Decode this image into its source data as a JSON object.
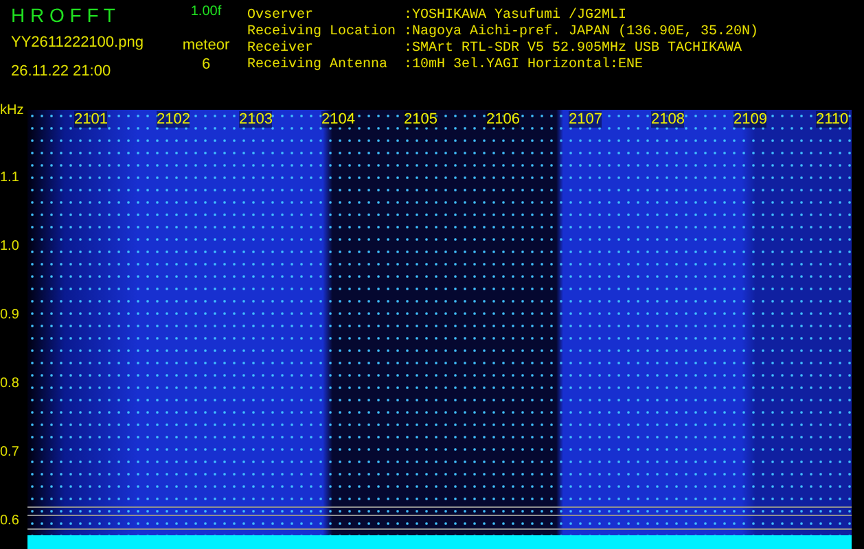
{
  "header": {
    "title": "H R O F F T",
    "version": "1.00f",
    "filename": "YY2611222100.png",
    "datetime": "26.11.22 21:00",
    "counter_label": "meteor",
    "counter_value": "6"
  },
  "info": [
    {
      "label": "Ovserver",
      "value": ":YOSHIKAWA Yasufumi /JG2MLI"
    },
    {
      "label": "Receiving Location",
      "value": ":Nagoya Aichi-pref. JAPAN (136.90E, 35.20N)"
    },
    {
      "label": "Receiver",
      "value": ":SMArt RTL-SDR V5 52.905MHz USB TACHIKAWA"
    },
    {
      "label": "Receiving Antenna",
      "value": ":10mH 3el.YAGI Horizontal:ENE"
    }
  ],
  "axis": {
    "unit": "kHz",
    "yticks": [
      "1.1",
      "1.0",
      "0.9",
      "0.8",
      "0.7",
      "0.6"
    ],
    "minutes": [
      "2101",
      "2102",
      "2103",
      "2104",
      "2105",
      "2106",
      "2107",
      "2108",
      "2109",
      "2110"
    ]
  }
}
